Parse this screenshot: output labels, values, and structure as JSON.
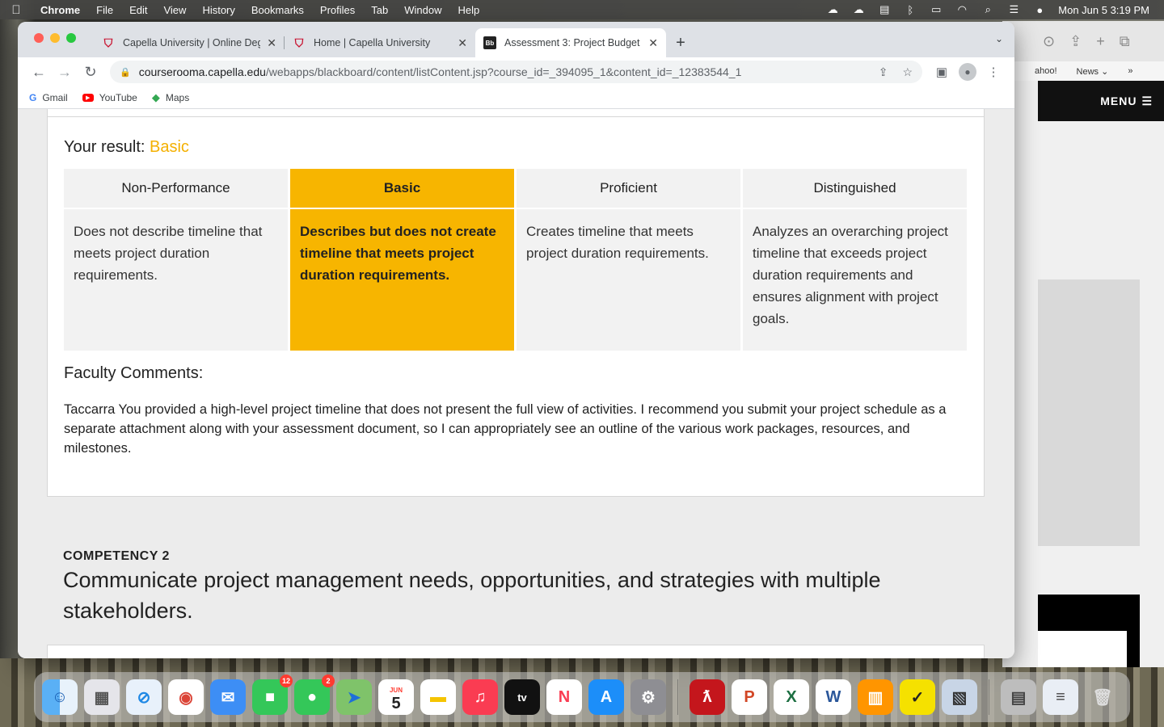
{
  "menubar": {
    "apple": "",
    "items": [
      "Chrome",
      "File",
      "Edit",
      "View",
      "History",
      "Bookmarks",
      "Profiles",
      "Tab",
      "Window",
      "Help"
    ],
    "clock": "Mon Jun 5  3:19 PM"
  },
  "browser": {
    "tabs": [
      {
        "title": "Capella University | Online Deg",
        "favicon": "capella-icon"
      },
      {
        "title": "Home | Capella University",
        "favicon": "capella-icon"
      },
      {
        "title": "Assessment 3: Project Budget",
        "favicon": "blackboard-icon"
      }
    ],
    "url_host": "courserooma.capella.edu",
    "url_path": "/webapps/blackboard/content/listContent.jsp?course_id=_394095_1&content_id=_12383544_1",
    "bookmarks": [
      "Gmail",
      "YouTube",
      "Maps"
    ]
  },
  "background_window": {
    "bookmarks": [
      "ahoo!",
      "News ⌄"
    ],
    "menu_label": "MENU"
  },
  "content": {
    "result_label": "Your result:",
    "result_value": "Basic",
    "rubric": {
      "headers": [
        "Non-Performance",
        "Basic",
        "Proficient",
        "Distinguished"
      ],
      "descriptions": [
        "Does not describe timeline that meets project duration requirements.",
        "Describes but does not create timeline that meets project duration requirements.",
        "Creates timeline that meets project duration requirements.",
        "Analyzes an overarching project timeline that exceeds project duration requirements and ensures alignment with project goals."
      ],
      "selected_index": 1
    },
    "faculty_comments_title": "Faculty Comments:",
    "faculty_comments": "Taccarra You provided a high-level project timeline that does not present the full view of activities. I recommend you submit your project schedule as a separate attachment along with your assessment document, so I can appropriately see an outline of the various work packages, resources, and milestones.",
    "competency_label": "COMPETENCY 2",
    "competency_title": "Communicate project management needs, opportunities, and strategies with multiple stakeholders."
  },
  "dock": {
    "badges": {
      "facetime": "12",
      "messages": "2"
    },
    "calendar_month": "JUN",
    "calendar_day": "5"
  },
  "colors": {
    "accent_selected": "#f7b500",
    "result_text": "#f4b000"
  }
}
